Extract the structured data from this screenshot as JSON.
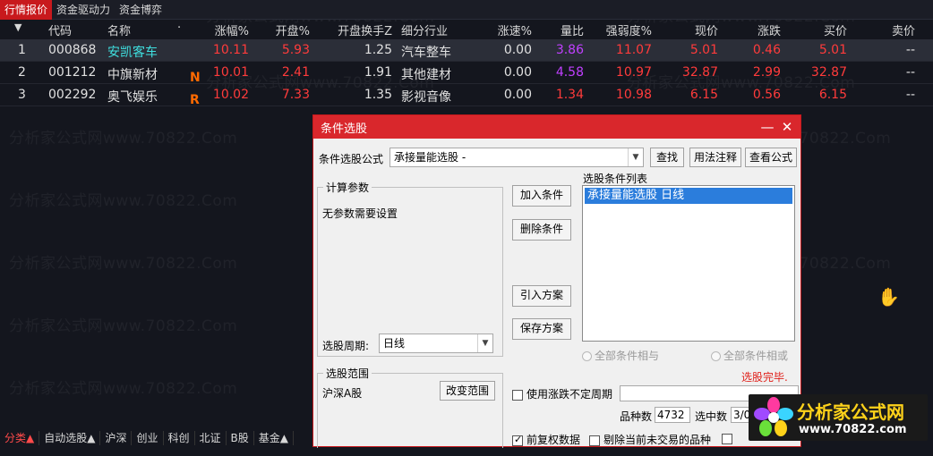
{
  "tabs": [
    "行情报价",
    "资金驱动力",
    "资金博弈"
  ],
  "header": {
    "arrow": "▼",
    "code": "代码",
    "name": "名称",
    "dot": "·",
    "chg_pct": "涨幅%",
    "open_pct": "开盘%",
    "open_turnover": "开盘换手Z",
    "industry": "细分行业",
    "speed": "涨速%",
    "vol_ratio": "量比",
    "strength": "强弱度%",
    "price": "现价",
    "change": "涨跌",
    "bid": "买价",
    "ask": "卖价"
  },
  "rows": [
    {
      "idx": "1",
      "code": "000868",
      "name": "安凯客车",
      "flag": "",
      "chg_pct": "10.11",
      "open_pct": "5.93",
      "open_turnover": "1.25",
      "industry": "汽车整车",
      "speed": "0.00",
      "vol_ratio": "3.86",
      "strength": "11.07",
      "price": "5.01",
      "change": "0.46",
      "bid": "5.01",
      "ask": "--"
    },
    {
      "idx": "2",
      "code": "001212",
      "name": "中旗新材",
      "flag": "N",
      "chg_pct": "10.01",
      "open_pct": "2.41",
      "open_turnover": "1.91",
      "industry": "其他建材",
      "speed": "0.00",
      "vol_ratio": "4.58",
      "strength": "10.97",
      "price": "32.87",
      "change": "2.99",
      "bid": "32.87",
      "ask": "--"
    },
    {
      "idx": "3",
      "code": "002292",
      "name": "奥飞娱乐",
      "flag": "R",
      "chg_pct": "10.02",
      "open_pct": "7.33",
      "open_turnover": "1.35",
      "industry": "影视音像",
      "speed": "0.00",
      "vol_ratio": "1.34",
      "strength": "10.98",
      "price": "6.15",
      "change": "0.56",
      "bid": "6.15",
      "ask": "--"
    }
  ],
  "watermark": "分析家公式网www.70822.Com",
  "bottom_bar": [
    "分类▲",
    "自动选股▲",
    "沪深",
    "创业",
    "科创",
    "北证",
    "B股",
    "基金▲"
  ],
  "dialog": {
    "title": "条件选股",
    "minimize": "—",
    "close": "✕",
    "formula_label": "条件选股公式",
    "formula_value": "承接量能选股 -",
    "find_btn": "查找",
    "usage_btn": "用法注释",
    "view_btn": "查看公式",
    "params_title": "计算参数",
    "params_text": "无参数需要设置",
    "add_btn": "加入条件",
    "delete_btn": "删除条件",
    "import_btn": "引入方案",
    "save_btn": "保存方案",
    "list_title": "选股条件列表",
    "list_items": [
      "承接量能选股  日线"
    ],
    "period_label": "选股周期:",
    "period_value": "日线",
    "radio_and": "全部条件相与",
    "radio_or": "全部条件相或",
    "status": "选股完毕.",
    "range_title": "选股范围",
    "range_value": "沪深A股",
    "change_range_btn": "改变范围",
    "uncertain_period": "使用涨跌不定周期",
    "count_label": "品种数",
    "count_value": "4732",
    "selected_label": "选中数",
    "selected_value": "3/0",
    "forward_adjust": "前复权数据",
    "exclude_untraded": "剔除当前未交易的品种"
  },
  "logo": {
    "name": "分析家公式网",
    "url": "www.70822.com"
  },
  "colors": {
    "accent": "#c8191d",
    "up": "#ff3b3b",
    "purple": "#c040ff",
    "cyan": "#3fe0e0",
    "selection": "#2b7ddc"
  }
}
